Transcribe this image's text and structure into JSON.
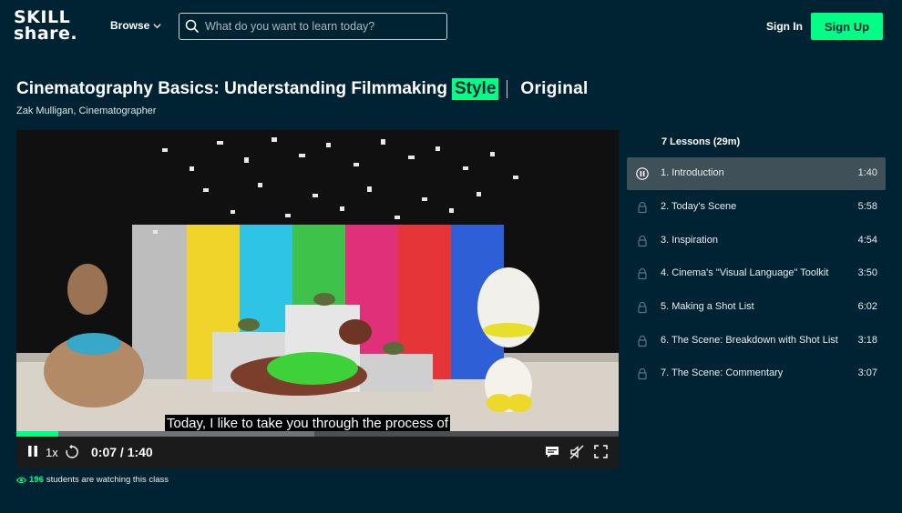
{
  "header": {
    "logo_line1": "SKILL",
    "logo_line2": "share.",
    "browse_label": "Browse",
    "search_placeholder": "What do you want to learn today?",
    "sign_in_label": "Sign In",
    "sign_up_label": "Sign Up"
  },
  "course": {
    "title": "Cinematography Basics: Understanding Filmmaking",
    "title_highlight": "Style",
    "badge": "Original",
    "teacher": "Zak Mulligan, Cinematographer"
  },
  "player": {
    "caption": "Today, I like to take you through the process of",
    "speed": "1x",
    "time_display": "0:07 / 1:40",
    "progress_fraction": 0.07,
    "icons": [
      "pause-icon",
      "rewind-15-icon",
      "captions-icon",
      "mute-icon",
      "fullscreen-icon"
    ]
  },
  "lessons": {
    "heading": "7 Lessons (29m)",
    "items": [
      {
        "title": "1. Introduction",
        "duration": "1:40",
        "state": "playing"
      },
      {
        "title": "2. Today's Scene",
        "duration": "5:58",
        "state": "locked"
      },
      {
        "title": "3. Inspiration",
        "duration": "4:54",
        "state": "locked"
      },
      {
        "title": "4. Cinema's \"Visual Language\" Toolkit",
        "duration": "3:50",
        "state": "locked"
      },
      {
        "title": "5. Making a Shot List",
        "duration": "6:02",
        "state": "locked"
      },
      {
        "title": "6. The Scene: Breakdown with Shot List",
        "duration": "3:18",
        "state": "locked"
      },
      {
        "title": "7. The Scene: Commentary",
        "duration": "3:07",
        "state": "locked"
      }
    ]
  },
  "watching": {
    "count": "196",
    "text": "students are watching this class"
  },
  "colors": {
    "background": "#002333",
    "accent": "#00ff84",
    "active_row": "#3f5058"
  }
}
